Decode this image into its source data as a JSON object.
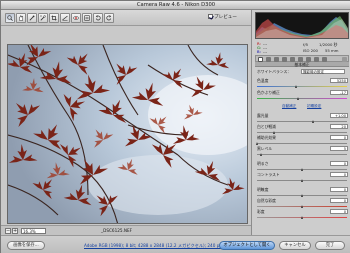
{
  "window": {
    "title": "Camera Raw 4.6 - Nikon D300"
  },
  "toolbar": {
    "tools": [
      "zoom-icon",
      "hand-icon",
      "white-balance-icon",
      "color-sampler-icon",
      "crop-icon",
      "straighten-icon",
      "red-eye-icon",
      "preferences-icon",
      "rotate-left-icon",
      "rotate-right-icon"
    ],
    "preview_label": "プレビュー",
    "preview_checked": true
  },
  "status": {
    "zoom_value": "16.3%",
    "filename": "_DSC6125.NEF"
  },
  "camera_info": {
    "aperture": "f/5",
    "shutter": "1/2000 秒",
    "iso": "ISO 200",
    "focal": "55 mm",
    "r_label": "R:",
    "g_label": "G:",
    "b_label": "B:",
    "r": "---",
    "g": "---",
    "b": "---"
  },
  "panel": {
    "section_title": "基本補正",
    "white_balance_label": "ホワイトバランス：",
    "white_balance_value": "撮影時の設定",
    "temp_label": "色温度",
    "temp_value": "5250",
    "tint_label": "色かぶり補正",
    "tint_value": "-17",
    "auto_label": "自動補正",
    "default_label": "初期設定",
    "exposure_label": "露光量",
    "exposure_value": "+1.00",
    "recovery_label": "白とび軽減",
    "recovery_value": "20",
    "fill_label": "補助光効果",
    "fill_value": "0",
    "blacks_label": "黒レベル",
    "blacks_value": "5",
    "brightness_label": "明るさ",
    "brightness_value": "0",
    "contrast_label": "コントラスト",
    "contrast_value": "0",
    "clarity_label": "明瞭度",
    "clarity_value": "0",
    "vibrance_label": "自然な彩度",
    "vibrance_value": "0",
    "saturation_label": "彩度",
    "saturation_value": "0"
  },
  "bottombar": {
    "save_label": "画像を保存...",
    "workflow_link": "Adobe RGB (1998); 8 bit; 4288 x 2848 (12.2 メガピクセル); 240 ppi",
    "open_label": "オブジェクトとして開く",
    "cancel_label": "キャンセル",
    "done_label": "完了"
  }
}
